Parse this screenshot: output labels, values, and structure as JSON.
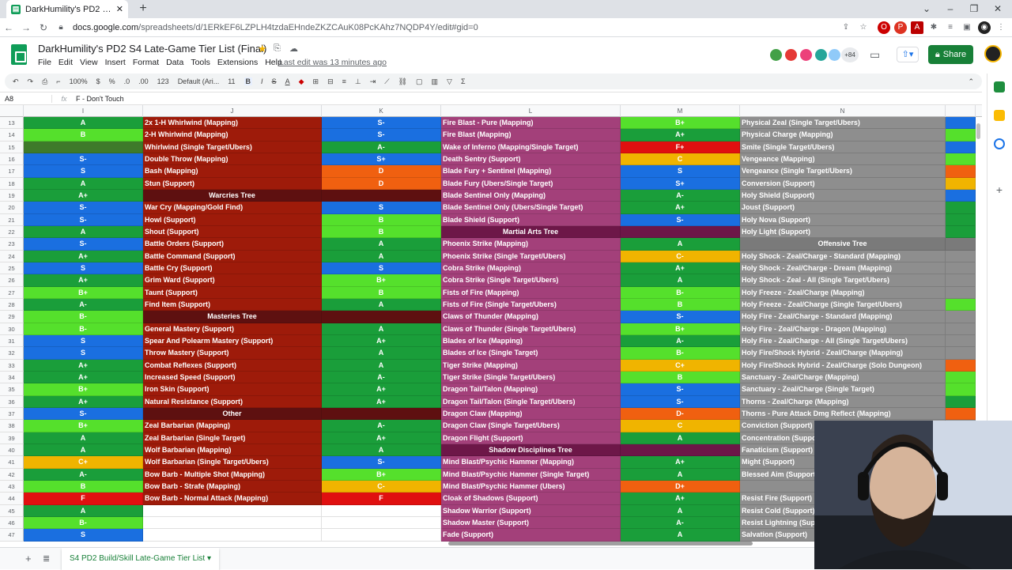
{
  "browser": {
    "tab_title": "DarkHumility's PD2 S4 Late-Game",
    "url_domain": "docs.google.com",
    "url_path": "/spreadsheets/d/1ERkEF6LZPLH4tzdaEHndeZKZCAuK08PcKAhz7NQDP4Y/edit#gid=0"
  },
  "doc": {
    "title": "DarkHumility's PD2 S4 Late-Game Tier List (Final)",
    "menus": [
      "File",
      "Edit",
      "View",
      "Insert",
      "Format",
      "Data",
      "Tools",
      "Extensions",
      "Help"
    ],
    "last_edit": "Last edit was 13 minutes ago",
    "avatar_count": "+84",
    "share_label": "Share"
  },
  "toolbar": {
    "zoom": "100%",
    "currency": "$",
    "percent": "%",
    "dec_less": ".0",
    "dec_more": ".00",
    "format_more": "123",
    "font": "Default (Ari...",
    "font_size": "11",
    "bold": "B",
    "italic": "I",
    "strike": "S",
    "textcolor": "A"
  },
  "formula_bar": {
    "cell": "A8",
    "fx": "fx",
    "value": "F - Don't Touch"
  },
  "columns": [
    "I",
    "J",
    "K",
    "L",
    "M",
    "N"
  ],
  "sheet_tab": "S4 PD2 Build/Skill Late-Game Tier List",
  "colors": {
    "S": "#1a6fe0",
    "A": "#1a9e3a",
    "B": "#55e02c",
    "C": "#f0b400",
    "D": "#f06010",
    "F": "#e01010",
    "olive": "#3e7a2a",
    "red_col": "#9e1b0a",
    "purple_col": "#a3407a",
    "gray_col": "#8e8e8e",
    "dark_hdr": "#5e1010",
    "purple_hdr": "#6d1748",
    "gray_hdr": "#7a7a7a"
  },
  "rows": [
    {
      "n": "13",
      "i": "A",
      "j": "2x 1-H Whirlwind (Mapping)",
      "k": "S-",
      "l": "Fire Blast - Pure (Mapping)",
      "m": "B+",
      "n2": "Physical Zeal (Single Target/Ubers)",
      "o": "S"
    },
    {
      "n": "14",
      "i": "B",
      "j": "2-H Whirlwind (Mapping)",
      "k": "S-",
      "l": "Fire Blast (Mapping)",
      "m": "A+",
      "n2": "Physical Charge (Mapping)",
      "o": "B"
    },
    {
      "n": "15",
      "i": "",
      "j": "Whirlwind (Single Target/Ubers)",
      "k": "A-",
      "l": "Wake of Inferno (Mapping/Single Target)",
      "m": "F+",
      "n2": "Smite (Single Target/Ubers)",
      "o": "S"
    },
    {
      "n": "16",
      "i": "S-",
      "j": "Double Throw (Mapping)",
      "k": "S+",
      "l": "Death Sentry (Support)",
      "m": "C",
      "n2": "Vengeance (Mapping)",
      "o": "B"
    },
    {
      "n": "17",
      "i": "S",
      "j": "Bash (Mapping)",
      "k": "D",
      "l": "Blade Fury + Sentinel (Mapping)",
      "m": "S",
      "n2": "Vengeance (Single Target/Ubers)",
      "o": "D"
    },
    {
      "n": "18",
      "i": "A",
      "j": "Stun (Support)",
      "k": "D",
      "l": "Blade Fury (Ubers/Single Target)",
      "m": "S+",
      "n2": "Conversion (Support)",
      "o": "C"
    },
    {
      "n": "19",
      "i": "A+",
      "j": "Warcries Tree",
      "jh": 1,
      "k": "",
      "l": "Blade Sentinel Only (Mapping)",
      "m": "A-",
      "n2": "Holy Shield (Support)",
      "o": "S"
    },
    {
      "n": "20",
      "i": "S-",
      "j": "War Cry (Mapping/Gold Find)",
      "k": "S",
      "l": "Blade Sentinel Only (Ubers/Single Target)",
      "m": "A+",
      "n2": "Joust (Support)",
      "o": "A"
    },
    {
      "n": "21",
      "i": "S-",
      "j": "Howl (Support)",
      "k": "B",
      "l": "Blade Shield (Support)",
      "m": "S-",
      "n2": "Holy Nova (Support)",
      "o": "A"
    },
    {
      "n": "22",
      "i": "A",
      "j": "Shout (Support)",
      "k": "B",
      "l": "Martial Arts Tree",
      "lh": 1,
      "m": "",
      "n2": "Holy Light (Support)",
      "o": "A"
    },
    {
      "n": "23",
      "i": "S-",
      "j": "Battle Orders (Support)",
      "k": "A",
      "l": "Phoenix Strike (Mapping)",
      "m": "A",
      "n2": "Offensive Tree",
      "nh": 1,
      "o": ""
    },
    {
      "n": "24",
      "i": "A+",
      "j": "Battle Command (Support)",
      "k": "A",
      "l": "Phoenix Strike (Single Target/Ubers)",
      "m": "C-",
      "n2": "Holy Shock - Zeal/Charge - Standard (Mapping)",
      "o": ""
    },
    {
      "n": "25",
      "i": "S",
      "j": "Battle Cry (Support)",
      "k": "S",
      "l": "Cobra Strike (Mapping)",
      "m": "A+",
      "n2": "Holy Shock - Zeal/Charge - Dream (Mapping)",
      "o": ""
    },
    {
      "n": "26",
      "i": "A+",
      "j": "Grim Ward (Support)",
      "k": "B+",
      "l": "Cobra Strike (Single Target/Ubers)",
      "m": "A",
      "n2": "Holy Shock - Zeal - All (Single Target/Ubers)",
      "o": ""
    },
    {
      "n": "27",
      "i": "B+",
      "j": "Taunt (Support)",
      "k": "B",
      "l": "Fists of Fire (Mapping)",
      "m": "B-",
      "n2": "Holy Freeze - Zeal/Charge (Mapping)",
      "o": ""
    },
    {
      "n": "28",
      "i": "A-",
      "j": "Find Item (Support)",
      "k": "A",
      "l": "Fists of Fire (Single Target/Ubers)",
      "m": "B",
      "n2": "Holy Freeze - Zeal/Charge (Single Target/Ubers)",
      "o": "B"
    },
    {
      "n": "29",
      "i": "B-",
      "j": "Masteries Tree",
      "jh": 1,
      "k": "",
      "l": "Claws of Thunder (Mapping)",
      "m": "S-",
      "n2": "Holy Fire - Zeal/Charge - Standard (Mapping)",
      "o": ""
    },
    {
      "n": "30",
      "i": "B-",
      "j": "General Mastery (Support)",
      "k": "A",
      "l": "Claws of Thunder (Single Target/Ubers)",
      "m": "B+",
      "n2": "Holy Fire - Zeal/Charge - Dragon (Mapping)",
      "o": ""
    },
    {
      "n": "31",
      "i": "S",
      "j": "Spear And Polearm Mastery (Support)",
      "k": "A+",
      "l": "Blades of Ice (Mapping)",
      "m": "A-",
      "n2": "Holy Fire - Zeal/Charge - All (Single Target/Ubers)",
      "o": ""
    },
    {
      "n": "32",
      "i": "S",
      "j": "Throw Mastery (Support)",
      "k": "A",
      "l": "Blades of Ice (Single Target)",
      "m": "B-",
      "n2": "Holy Fire/Shock Hybrid - Zeal/Charge (Mapping)",
      "o": ""
    },
    {
      "n": "33",
      "i": "A+",
      "j": "Combat Reflexes (Support)",
      "k": "A",
      "l": "Tiger Strike (Mapping)",
      "m": "C+",
      "n2": "Holy Fire/Shock Hybrid - Zeal/Charge (Solo Dungeon)",
      "o": "D"
    },
    {
      "n": "34",
      "i": "A+",
      "j": "Increased Speed (Support)",
      "k": "A-",
      "l": "Tiger Strike (Single Target/Ubers)",
      "m": "B",
      "n2": "Sanctuary - Zeal/Charge (Mapping)",
      "o": "B"
    },
    {
      "n": "35",
      "i": "B+",
      "j": "Iron Skin (Support)",
      "k": "A+",
      "l": "Dragon Tail/Talon (Mapping)",
      "m": "S-",
      "n2": "Sanctuary - Zeal/Charge (Single Target)",
      "o": "B"
    },
    {
      "n": "36",
      "i": "A+",
      "j": "Natural Resistance (Support)",
      "k": "A+",
      "l": "Dragon Tail/Talon (Single Target/Ubers)",
      "m": "S-",
      "n2": "Thorns - Zeal/Charge (Mapping)",
      "o": "A"
    },
    {
      "n": "37",
      "i": "S-",
      "j": "Other",
      "jh": 1,
      "k": "",
      "l": "Dragon Claw (Mapping)",
      "m": "D-",
      "n2": "Thorns - Pure Attack Dmg Reflect (Mapping)",
      "o": "D"
    },
    {
      "n": "38",
      "i": "B+",
      "j": "Zeal Barbarian (Mapping)",
      "k": "A-",
      "l": "Dragon Claw (Single Target/Ubers)",
      "m": "C",
      "n2": "Conviction (Support)",
      "o": ""
    },
    {
      "n": "39",
      "i": "A",
      "j": "Zeal Barbarian (Single Target)",
      "k": "A+",
      "l": "Dragon Flight (Support)",
      "m": "A",
      "n2": "Concentration (Support)",
      "o": ""
    },
    {
      "n": "40",
      "i": "A",
      "j": "Wolf Barbarian (Mapping)",
      "k": "A",
      "l": "Shadow Disciplines Tree",
      "lh": 1,
      "m": "",
      "n2": "Fanaticism (Support)",
      "o": ""
    },
    {
      "n": "41",
      "i": "C+",
      "j": "Wolf Barbarian (Single Target/Ubers)",
      "k": "S-",
      "l": "Mind Blast/Psychic Hammer (Mapping)",
      "m": "A+",
      "n2": "Might (Support)",
      "o": ""
    },
    {
      "n": "42",
      "i": "A-",
      "j": "Bow Barb - Multiple Shot (Mapping)",
      "k": "B+",
      "l": "Mind Blast/Psychic Hammer (Single Target)",
      "m": "A",
      "n2": "Blessed Aim (Support)",
      "o": ""
    },
    {
      "n": "43",
      "i": "B",
      "j": "Bow Barb - Strafe (Mapping)",
      "k": "C-",
      "l": "Mind Blast/Psychic Hammer (Ubers)",
      "m": "D+",
      "n2": "",
      "o": ""
    },
    {
      "n": "44",
      "i": "F",
      "j": "Bow Barb - Normal Attack (Mapping)",
      "k": "F",
      "l": "Cloak of Shadows (Support)",
      "m": "A+",
      "n2": "Resist Fire (Support)",
      "o": ""
    },
    {
      "n": "45",
      "i": "A",
      "j": "",
      "k": "",
      "l": "Shadow Warrior (Support)",
      "m": "A",
      "n2": "Resist Cold (Support)",
      "o": ""
    },
    {
      "n": "46",
      "i": "B-",
      "j": "",
      "k": "",
      "l": "Shadow Master (Support)",
      "m": "A-",
      "n2": "Resist Lightning (Support)",
      "o": ""
    },
    {
      "n": "47",
      "i": "S",
      "j": "",
      "k": "",
      "l": "Fade (Support)",
      "m": "A",
      "n2": "Salvation (Support)",
      "o": ""
    }
  ]
}
